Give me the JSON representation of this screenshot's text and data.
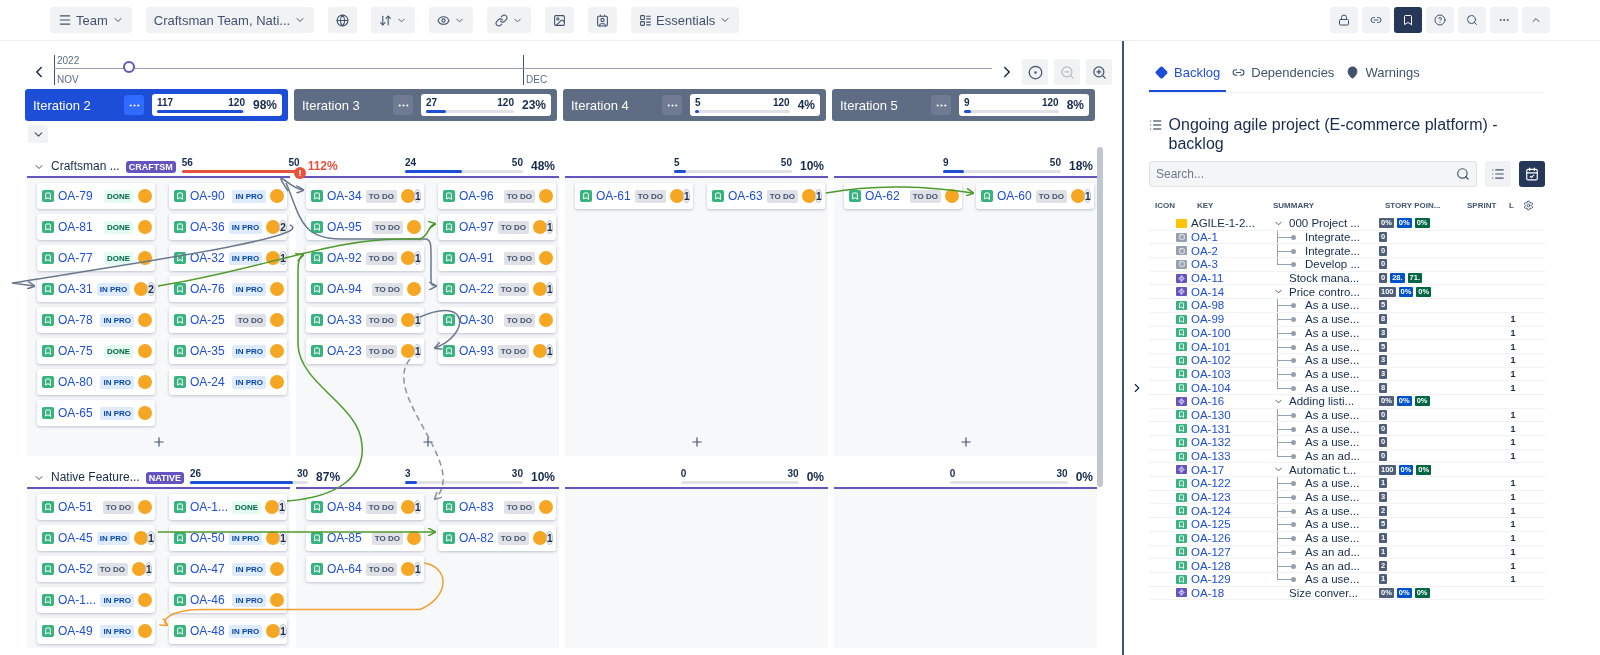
{
  "toolbar": {
    "team_button": "Team",
    "filter": "Craftsman Team, Nati...",
    "view": "Essentials",
    "right_buttons": [
      {
        "selected": false
      },
      {
        "selected": false
      },
      {
        "selected": true
      },
      {
        "selected": false
      },
      {
        "selected": false
      },
      {
        "selected": false
      },
      {
        "selected": false
      }
    ]
  },
  "timeline": {
    "year": "2022",
    "months": [
      "NOV",
      "DEC"
    ],
    "level": 0.08
  },
  "iterations": [
    {
      "name": "Iteration 2",
      "selected": true,
      "done": "117",
      "total": "120",
      "level": 0.975,
      "percent": "98%"
    },
    {
      "name": "Iteration 3",
      "selected": false,
      "done": "27",
      "total": "120",
      "level": 0.225,
      "percent": "23%"
    },
    {
      "name": "Iteration 4",
      "selected": false,
      "done": "5",
      "total": "120",
      "level": 0.04,
      "percent": "4%"
    },
    {
      "name": "Iteration 5",
      "selected": false,
      "done": "9",
      "total": "120",
      "level": 0.075,
      "percent": "8%"
    }
  ],
  "swimlanes": [
    {
      "name": "Craftsman ...",
      "badge": "CRAFTSM",
      "expanded": true,
      "columns": [
        {
          "done": "56",
          "total": "50",
          "percent": "112%",
          "level": 1,
          "over": true,
          "cards": [
            [
              {
                "key": "OA-79",
                "status": "DONE",
                "kind": "done"
              },
              {
                "key": "OA-81",
                "status": "DONE",
                "kind": "done"
              },
              {
                "key": "OA-77",
                "status": "DONE",
                "kind": "done"
              },
              {
                "key": "OA-31",
                "status": "IN PRO",
                "kind": "progress",
                "links": "2"
              },
              {
                "key": "OA-78",
                "status": "IN PRO",
                "kind": "progress"
              },
              {
                "key": "OA-75",
                "status": "DONE",
                "kind": "done"
              },
              {
                "key": "OA-80",
                "status": "IN PRO",
                "kind": "progress"
              },
              {
                "key": "OA-65",
                "status": "IN PRO",
                "kind": "progress"
              }
            ],
            [
              {
                "key": "OA-90",
                "status": "IN PRO",
                "kind": "progress"
              },
              {
                "key": "OA-36",
                "status": "IN PRO",
                "kind": "progress",
                "links": "2"
              },
              {
                "key": "OA-32",
                "status": "IN PRO",
                "kind": "progress",
                "links": "1"
              },
              {
                "key": "OA-76",
                "status": "IN PRO",
                "kind": "progress"
              },
              {
                "key": "OA-25",
                "status": "TO DO",
                "kind": "todo"
              },
              {
                "key": "OA-35",
                "status": "IN PRO",
                "kind": "progress"
              },
              {
                "key": "OA-24",
                "status": "IN PRO",
                "kind": "progress"
              }
            ]
          ]
        },
        {
          "done": "24",
          "total": "50",
          "percent": "48%",
          "level": 0.48,
          "over": false,
          "cards": [
            [
              {
                "key": "OA-34",
                "status": "TO DO",
                "kind": "todo",
                "links": "1"
              },
              {
                "key": "OA-95",
                "status": "TO DO",
                "kind": "todo"
              },
              {
                "key": "OA-92",
                "status": "TO DO",
                "kind": "todo",
                "links": "1"
              },
              {
                "key": "OA-94",
                "status": "TO DO",
                "kind": "todo"
              },
              {
                "key": "OA-33",
                "status": "TO DO",
                "kind": "todo",
                "links": "1"
              },
              {
                "key": "OA-23",
                "status": "TO DO",
                "kind": "todo",
                "links": "1"
              }
            ],
            [
              {
                "key": "OA-96",
                "status": "TO DO",
                "kind": "todo"
              },
              {
                "key": "OA-97",
                "status": "TO DO",
                "kind": "todo",
                "links": "1"
              },
              {
                "key": "OA-91",
                "status": "TO DO",
                "kind": "todo"
              },
              {
                "key": "OA-22",
                "status": "TO DO",
                "kind": "todo",
                "links": "1"
              },
              {
                "key": "OA-30",
                "status": "TO DO",
                "kind": "todo"
              },
              {
                "key": "OA-93",
                "status": "TO DO",
                "kind": "todo",
                "links": "1"
              }
            ]
          ]
        },
        {
          "done": "5",
          "total": "50",
          "percent": "10%",
          "level": 0.1,
          "over": false,
          "cards": [
            [
              {
                "key": "OA-61",
                "status": "TO DO",
                "kind": "todo",
                "links": "1"
              }
            ],
            [
              {
                "key": "OA-63",
                "status": "TO DO",
                "kind": "todo",
                "links": "1"
              }
            ]
          ]
        },
        {
          "done": "9",
          "total": "50",
          "percent": "18%",
          "level": 0.18,
          "over": false,
          "cards": [
            [
              {
                "key": "OA-62",
                "status": "TO DO",
                "kind": "todo"
              }
            ],
            [
              {
                "key": "OA-60",
                "status": "TO DO",
                "kind": "todo",
                "links": "1"
              }
            ]
          ]
        }
      ]
    },
    {
      "name": "Native Feature...",
      "badge": "NATIVE",
      "expanded": true,
      "columns": [
        {
          "done": "26",
          "total": "30",
          "percent": "87%",
          "level": 0.87,
          "over": false,
          "cards": [
            [
              {
                "key": "OA-51",
                "status": "TO DO",
                "kind": "todo"
              },
              {
                "key": "OA-45",
                "status": "IN PRO",
                "kind": "progress",
                "links": "1"
              },
              {
                "key": "OA-52",
                "status": "TO DO",
                "kind": "todo",
                "links": "1"
              },
              {
                "key": "OA-1...",
                "status": "IN PRO",
                "kind": "progress"
              },
              {
                "key": "OA-49",
                "status": "IN PRO",
                "kind": "progress"
              }
            ],
            [
              {
                "key": "OA-1...",
                "status": "DONE",
                "kind": "done",
                "links": "1"
              },
              {
                "key": "OA-50",
                "status": "IN PRO",
                "kind": "progress",
                "links": "1"
              },
              {
                "key": "OA-47",
                "status": "IN PRO",
                "kind": "progress"
              },
              {
                "key": "OA-46",
                "status": "IN PRO",
                "kind": "progress"
              },
              {
                "key": "OA-48",
                "status": "IN PRO",
                "kind": "progress",
                "links": "1"
              }
            ]
          ]
        },
        {
          "done": "3",
          "total": "30",
          "percent": "10%",
          "level": 0.1,
          "over": false,
          "cards": [
            [
              {
                "key": "OA-84",
                "status": "TO DO",
                "kind": "todo",
                "links": "1"
              },
              {
                "key": "OA-85",
                "status": "TO DO",
                "kind": "todo"
              },
              {
                "key": "OA-64",
                "status": "TO DO",
                "kind": "todo",
                "links": "1"
              }
            ],
            [
              {
                "key": "OA-83",
                "status": "TO DO",
                "kind": "todo"
              },
              {
                "key": "OA-82",
                "status": "TO DO",
                "kind": "todo",
                "links": "1"
              }
            ]
          ]
        },
        {
          "done": "0",
          "total": "30",
          "percent": "0%",
          "over": false
        },
        {
          "done": "0",
          "total": "30",
          "percent": "0%",
          "over": false
        }
      ]
    }
  ],
  "backlog": {
    "tabs": [
      {
        "label": "Backlog",
        "selected": true,
        "kind": "diamond"
      },
      {
        "label": "Dependencies",
        "selected": false,
        "kind": "link"
      },
      {
        "label": "Warnings",
        "selected": false,
        "kind": "pin"
      }
    ],
    "title": "Ongoing agile project (E-commerce platform) - backlog",
    "search": {
      "placeholder": "Search..."
    },
    "view_buttons": [
      {
        "selected": false
      },
      {
        "selected": true
      }
    ],
    "columns": [
      "ICON",
      "KEY",
      "SUMMARY",
      "STORY POIN...",
      "SPRINT",
      "L"
    ],
    "rows": [
      {
        "kind": "initiative",
        "key": "AGILE-1-2...",
        "summary": "000 Project ...",
        "points": [
          "0%",
          "0%",
          "0%"
        ],
        "expanded": true,
        "children": [
          {
            "kind": "task",
            "key": "OA-1",
            "summary": "Integrate...",
            "points": [
              "0"
            ]
          },
          {
            "kind": "task",
            "key": "OA-2",
            "summary": "Integrate...",
            "points": [
              "0"
            ]
          },
          {
            "kind": "task",
            "key": "OA-3",
            "summary": "Develop ...",
            "points": [
              "0"
            ]
          }
        ]
      },
      {
        "kind": "epic",
        "key": "OA-11",
        "summary": "Stock mana...",
        "points": [
          "0",
          "28.",
          "71."
        ]
      },
      {
        "kind": "epic",
        "key": "OA-14",
        "summary": "Price contro...",
        "points": [
          "100",
          "0%",
          "0%"
        ],
        "expanded": true,
        "children": [
          {
            "kind": "story",
            "key": "OA-98",
            "summary": "As a use...",
            "points": [
              "5"
            ]
          },
          {
            "kind": "story",
            "key": "OA-99",
            "summary": "As a use...",
            "points": [
              "8"
            ],
            "l": "1"
          },
          {
            "kind": "story",
            "key": "OA-100",
            "summary": "As a use...",
            "points": [
              "3"
            ],
            "l": "1"
          },
          {
            "kind": "story",
            "key": "OA-101",
            "summary": "As a use...",
            "points": [
              "5"
            ],
            "l": "1"
          },
          {
            "kind": "story",
            "key": "OA-102",
            "summary": "As a use...",
            "points": [
              "3"
            ],
            "l": "1"
          },
          {
            "kind": "story",
            "key": "OA-103",
            "summary": "As a use...",
            "points": [
              "3"
            ],
            "l": "1"
          },
          {
            "kind": "story",
            "key": "OA-104",
            "summary": "As a use...",
            "points": [
              "8"
            ],
            "l": "1"
          }
        ]
      },
      {
        "kind": "epic",
        "key": "OA-16",
        "summary": "Adding listi...",
        "points": [
          "0%",
          "0%",
          "0%"
        ],
        "expanded": true,
        "children": [
          {
            "kind": "story",
            "key": "OA-130",
            "summary": "As a use...",
            "points": [
              "0"
            ],
            "l": "1"
          },
          {
            "kind": "story",
            "key": "OA-131",
            "summary": "As a use...",
            "points": [
              "0"
            ],
            "l": "1"
          },
          {
            "kind": "story",
            "key": "OA-132",
            "summary": "As a use...",
            "points": [
              "0"
            ],
            "l": "1"
          },
          {
            "kind": "story",
            "key": "OA-133",
            "summary": "As an ad...",
            "points": [
              "0"
            ],
            "l": "1"
          }
        ]
      },
      {
        "kind": "epic",
        "key": "OA-17",
        "summary": "Automatic t...",
        "points": [
          "100",
          "0%",
          "0%"
        ],
        "expanded": true,
        "children": [
          {
            "kind": "story",
            "key": "OA-122",
            "summary": "As a use...",
            "points": [
              "1"
            ],
            "l": "1"
          },
          {
            "kind": "story",
            "key": "OA-123",
            "summary": "As a use...",
            "points": [
              "3"
            ],
            "l": "1"
          },
          {
            "kind": "story",
            "key": "OA-124",
            "summary": "As a use...",
            "points": [
              "2"
            ],
            "l": "1"
          },
          {
            "kind": "story",
            "key": "OA-125",
            "summary": "As a use...",
            "points": [
              "5"
            ],
            "l": "1"
          },
          {
            "kind": "story",
            "key": "OA-126",
            "summary": "As a use...",
            "points": [
              "1"
            ],
            "l": "1"
          },
          {
            "kind": "story",
            "key": "OA-127",
            "summary": "As an ad...",
            "points": [
              "1"
            ],
            "l": "1"
          },
          {
            "kind": "story",
            "key": "OA-128",
            "summary": "As an ad...",
            "points": [
              "2"
            ],
            "l": "1"
          },
          {
            "kind": "story",
            "key": "OA-129",
            "summary": "As a use...",
            "points": [
              "1"
            ],
            "l": "1"
          }
        ]
      },
      {
        "kind": "epic",
        "key": "OA-18",
        "summary": "Size conver...",
        "points": [
          "0%",
          "0%",
          "0%"
        ]
      }
    ]
  }
}
